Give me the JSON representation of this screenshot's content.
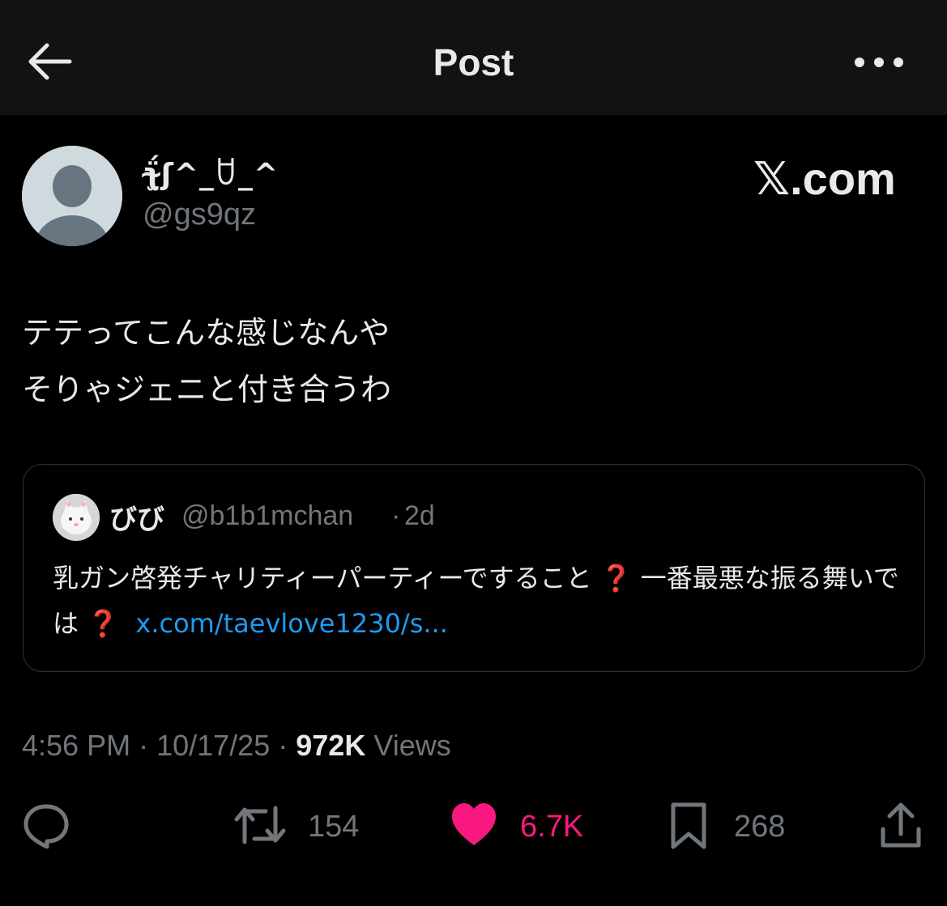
{
  "header": {
    "title": "Post",
    "back_icon": "arrow-left-icon",
    "more_icon": "more-horizontal-icon"
  },
  "post": {
    "author": {
      "display_name": "ʅ̴̫̈́ʃ^_ꇴ_^",
      "handle": "@gs9qz"
    },
    "watermark": "𝕏.com",
    "text_lines": [
      "テテってこんな感じなんや",
      "そりゃジェニと付き合うわ"
    ],
    "quote": {
      "name": "びび",
      "handle": "@b1b1mchan",
      "time": "2d",
      "text_part1": "乳ガン啓発チャリティーパーティーですること",
      "emoji1": "❓",
      "text_part2": "一番最悪な振る舞いでは",
      "emoji2": "❓",
      "link": "x.com/taevlove1230/s..."
    },
    "meta": {
      "time": "4:56 PM",
      "date": "10/17/25",
      "views": "972K",
      "views_label": "Views"
    },
    "actions": {
      "reply": {
        "icon": "reply-icon",
        "count": ""
      },
      "retweet": {
        "icon": "retweet-icon",
        "count": "154"
      },
      "like": {
        "icon": "heart-icon",
        "count": "6.7K",
        "liked": true,
        "color": "#f91880"
      },
      "bookmark": {
        "icon": "bookmark-icon",
        "count": "268"
      },
      "share": {
        "icon": "share-icon",
        "count": ""
      }
    }
  },
  "colors": {
    "background": "#000000",
    "header_bg": "#121212",
    "text": "#e7e9ea",
    "muted": "#71767b",
    "link": "#1d9bf0",
    "like": "#f91880"
  }
}
